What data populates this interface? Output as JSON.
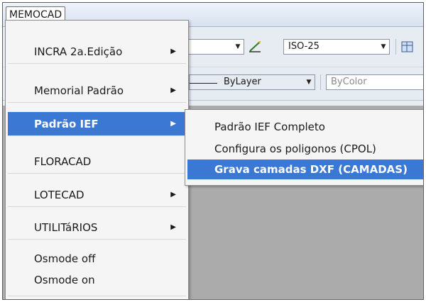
{
  "menubar": {
    "title": "MEMOCAD"
  },
  "toolbar": {
    "dimstyle_value": "ISO-25",
    "linetype_value": "ByLayer",
    "color_value": "ByColor"
  },
  "menu": {
    "items": [
      {
        "label": "INCRA 2a.Edição"
      },
      {
        "label": "Memorial Padrão"
      },
      {
        "label": "Padrão IEF"
      },
      {
        "label": "FLORACAD"
      },
      {
        "label": "LOTECAD"
      },
      {
        "label": "UTILITáRIOS"
      },
      {
        "label": "Osmode off"
      },
      {
        "label": "Osmode on"
      }
    ],
    "selected_index": 2
  },
  "submenu": {
    "items": [
      {
        "label": "Padrão IEF Completo"
      },
      {
        "label": "Configura os poligonos (CPOL)"
      },
      {
        "label": "Grava camadas DXF (CAMADAS)"
      }
    ],
    "selected_index": 2
  },
  "icons": {
    "submenu_arrow": "triangle-right-icon",
    "dropdown_arrow": "triangle-down-icon",
    "dimstyle": "dimension-style-icon"
  },
  "colors": {
    "highlight": "#3a78d4",
    "menu_bg": "#f5f5f5",
    "workspace": "#ababab"
  }
}
